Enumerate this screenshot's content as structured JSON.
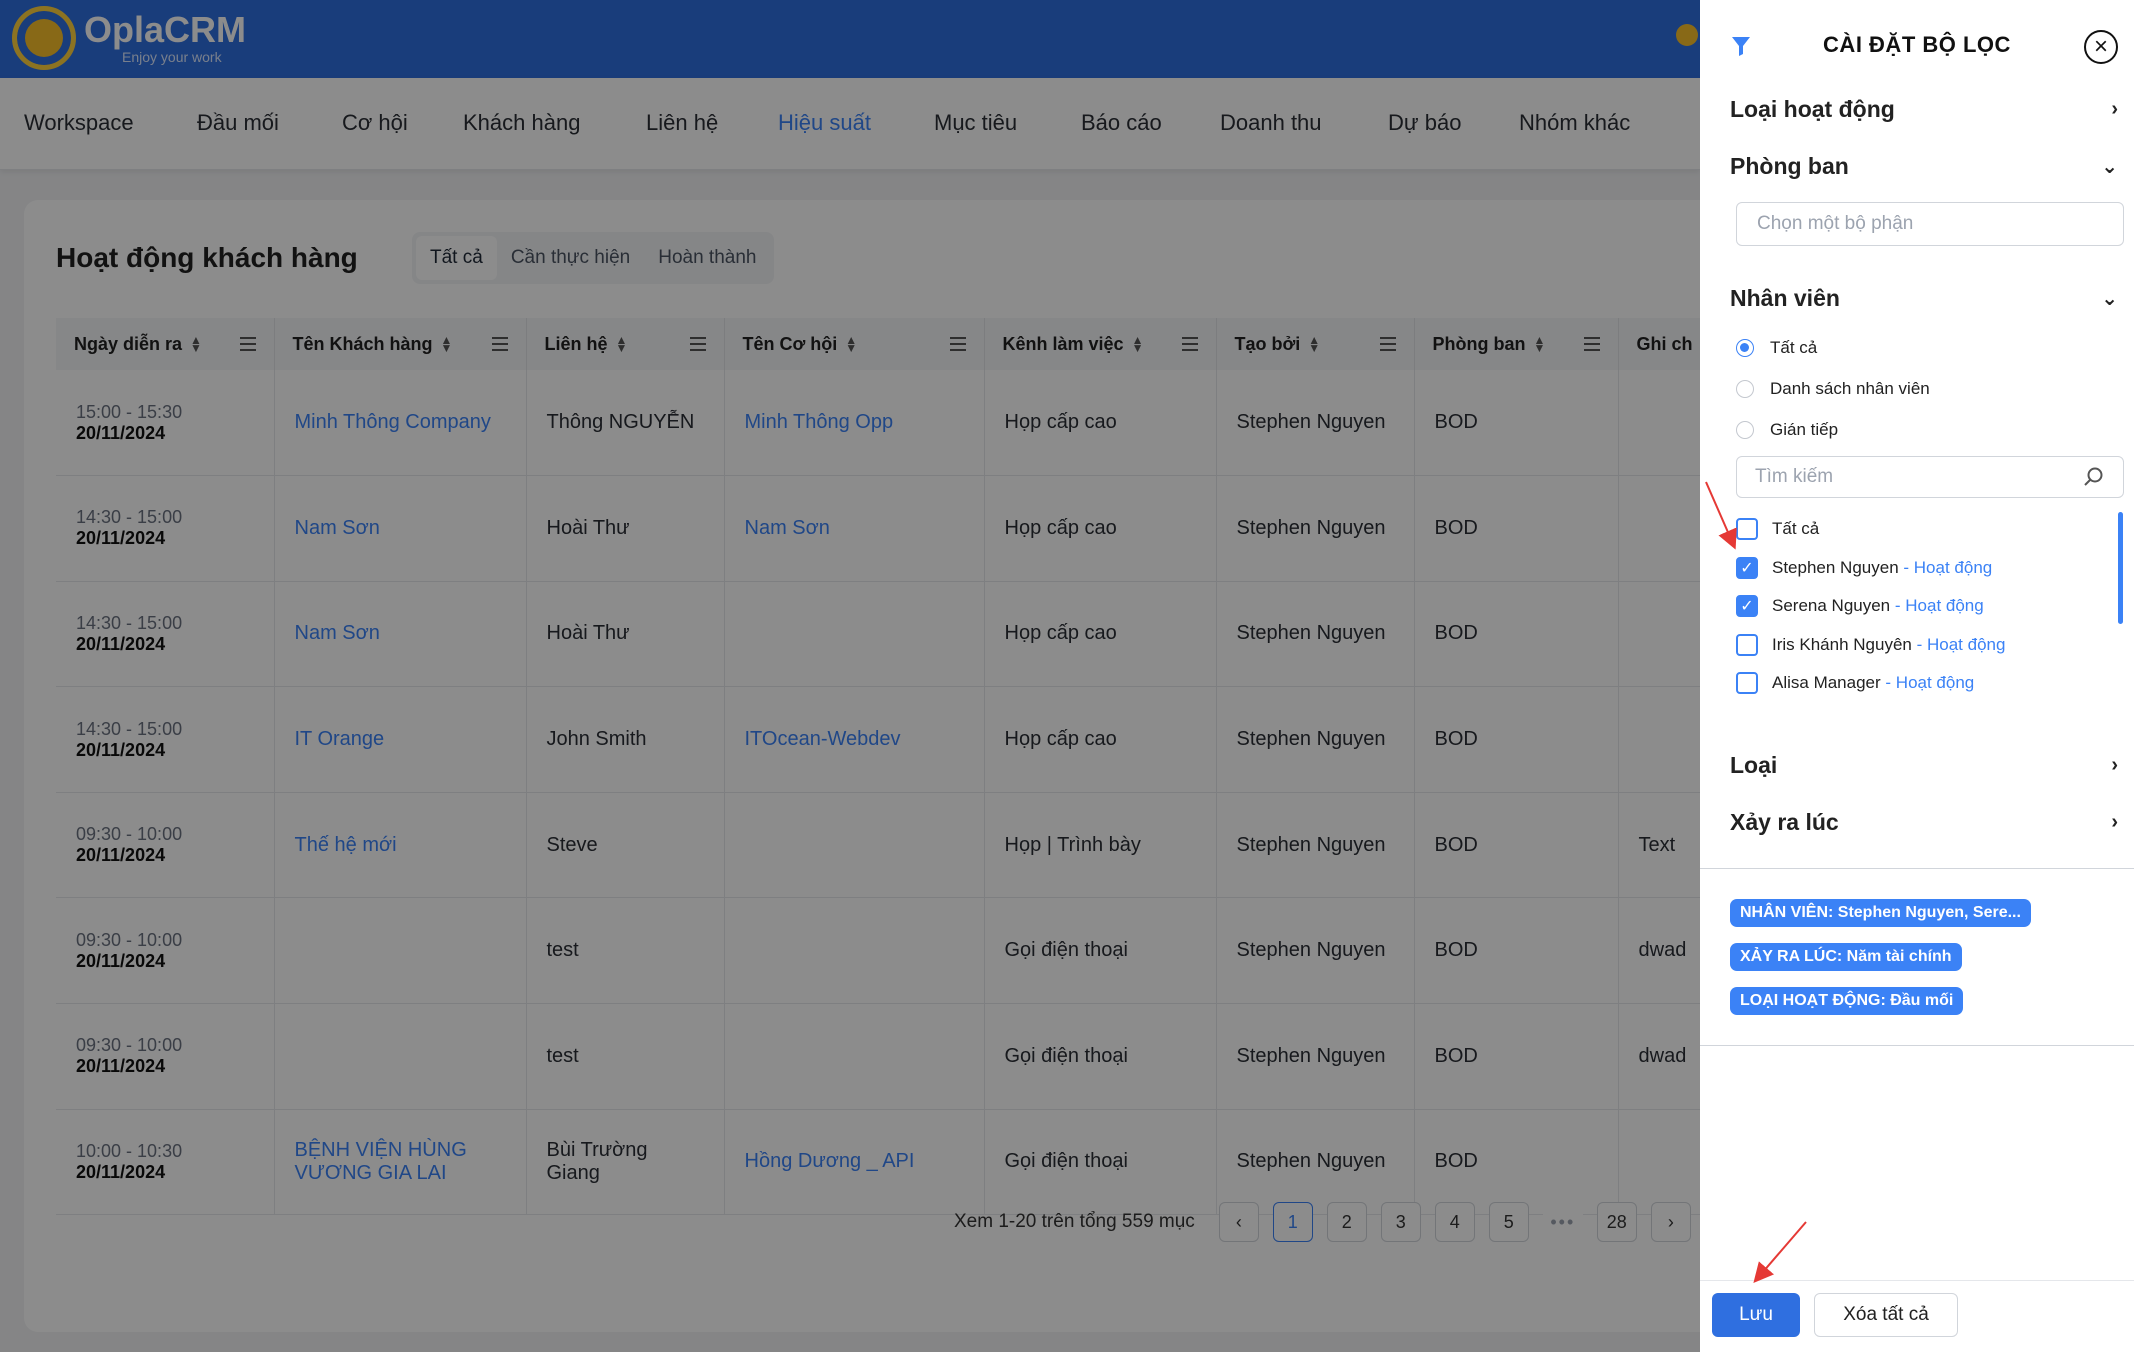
{
  "app": {
    "name": "OplaCRM",
    "tagline": "Enjoy your work"
  },
  "nav": [
    "Workspace",
    "Đầu mối",
    "Cơ hội",
    "Khách hàng",
    "Liên hệ",
    "Hiệu suất",
    "Mục tiêu",
    "Báo cáo",
    "Doanh thu",
    "Dự báo",
    "Nhóm khác"
  ],
  "nav_active": "Hiệu suất",
  "page": {
    "title": "Hoạt động khách hàng",
    "tabs": [
      "Tất cả",
      "Cần thực hiện",
      "Hoàn thành"
    ],
    "active_tab": "Tất cả"
  },
  "table": {
    "headers": [
      "Ngày diễn ra",
      "Tên Khách hàng",
      "Liên hệ",
      "Tên Cơ hội",
      "Kênh làm việc",
      "Tạo bởi",
      "Phòng ban",
      "Ghi ch"
    ],
    "rows": [
      {
        "time": "15:00 - 15:30",
        "date": "20/11/2024",
        "customer": "Minh Thông Company",
        "contact": "Thông NGUYỄN",
        "opportunity": "Minh Thông Opp",
        "channel": "Họp cấp cao",
        "created_by": "Stephen Nguyen",
        "dept": "BOD",
        "note": ""
      },
      {
        "time": "14:30 - 15:00",
        "date": "20/11/2024",
        "customer": "Nam Sơn",
        "contact": "Hoài Thư",
        "opportunity": "Nam Sơn",
        "channel": "Họp cấp cao",
        "created_by": "Stephen Nguyen",
        "dept": "BOD",
        "note": ""
      },
      {
        "time": "14:30 - 15:00",
        "date": "20/11/2024",
        "customer": "Nam Sơn",
        "contact": "Hoài Thư",
        "opportunity": "",
        "channel": "Họp cấp cao",
        "created_by": "Stephen Nguyen",
        "dept": "BOD",
        "note": ""
      },
      {
        "time": "14:30 - 15:00",
        "date": "20/11/2024",
        "customer": "IT Orange",
        "contact": "John Smith",
        "opportunity": "ITOcean-Webdev",
        "channel": "Họp cấp cao",
        "created_by": "Stephen Nguyen",
        "dept": "BOD",
        "note": ""
      },
      {
        "time": "09:30 - 10:00",
        "date": "20/11/2024",
        "customer": "Thế hệ mới",
        "contact": "Steve",
        "opportunity": "",
        "channel": "Họp | Trình bày",
        "created_by": "Stephen Nguyen",
        "dept": "BOD",
        "note": "Text"
      },
      {
        "time": "09:30 - 10:00",
        "date": "20/11/2024",
        "customer": "",
        "contact": "test",
        "opportunity": "",
        "channel": "Gọi điện thoại",
        "created_by": "Stephen Nguyen",
        "dept": "BOD",
        "note": "dwad"
      },
      {
        "time": "09:30 - 10:00",
        "date": "20/11/2024",
        "customer": "",
        "contact": "test",
        "opportunity": "",
        "channel": "Gọi điện thoại",
        "created_by": "Stephen Nguyen",
        "dept": "BOD",
        "note": "dwad"
      },
      {
        "time": "10:00 - 10:30",
        "date": "20/11/2024",
        "customer": "BỆNH VIỆN HÙNG VƯƠNG GIA LAI",
        "contact": "Bùi Trường Giang",
        "opportunity": "Hồng Dương _ API",
        "channel": "Gọi điện thoại",
        "created_by": "Stephen Nguyen",
        "dept": "BOD",
        "note": ""
      }
    ]
  },
  "pagination": {
    "info": "Xem 1-20 trên tổng 559 mục",
    "prev": "‹",
    "next": "›",
    "pages": [
      "1",
      "2",
      "3",
      "4",
      "5",
      "•••",
      "28"
    ],
    "current": "1"
  },
  "filter": {
    "title": "CÀI ĐẶT BỘ LỌC",
    "close_icon": "×",
    "sections": {
      "activity_type": "Loại hoạt động",
      "department": "Phòng ban",
      "employee": "Nhân viên",
      "type": "Loại",
      "occurred_at": "Xảy ra lúc"
    },
    "department_placeholder": "Chọn một bộ phận",
    "radios": [
      {
        "label": "Tất cả",
        "selected": true
      },
      {
        "label": "Danh sách nhân viên",
        "selected": false
      },
      {
        "label": "Gián tiếp",
        "selected": false
      }
    ],
    "search_placeholder": "Tìm kiếm",
    "select_all": "Tất cả",
    "employees": [
      {
        "name": "Stephen Nguyen",
        "status": "- Hoạt động",
        "checked": true
      },
      {
        "name": "Serena Nguyen",
        "status": "- Hoạt động",
        "checked": true
      },
      {
        "name": "Iris Khánh Nguyên",
        "status": "- Hoạt động",
        "checked": false
      },
      {
        "name": "Alisa Manager",
        "status": "- Hoạt động",
        "checked": false
      }
    ],
    "chips": [
      "NHÂN VIÊN: Stephen Nguyen, Sere...",
      "XẢY RA LÚC: Năm tài chính",
      "LOẠI HOẠT ĐỘNG: Đầu mối"
    ],
    "save": "Lưu",
    "clear": "Xóa tất cả"
  },
  "colors": {
    "brand": "#2f6fe0",
    "accent": "#3b82f6"
  }
}
